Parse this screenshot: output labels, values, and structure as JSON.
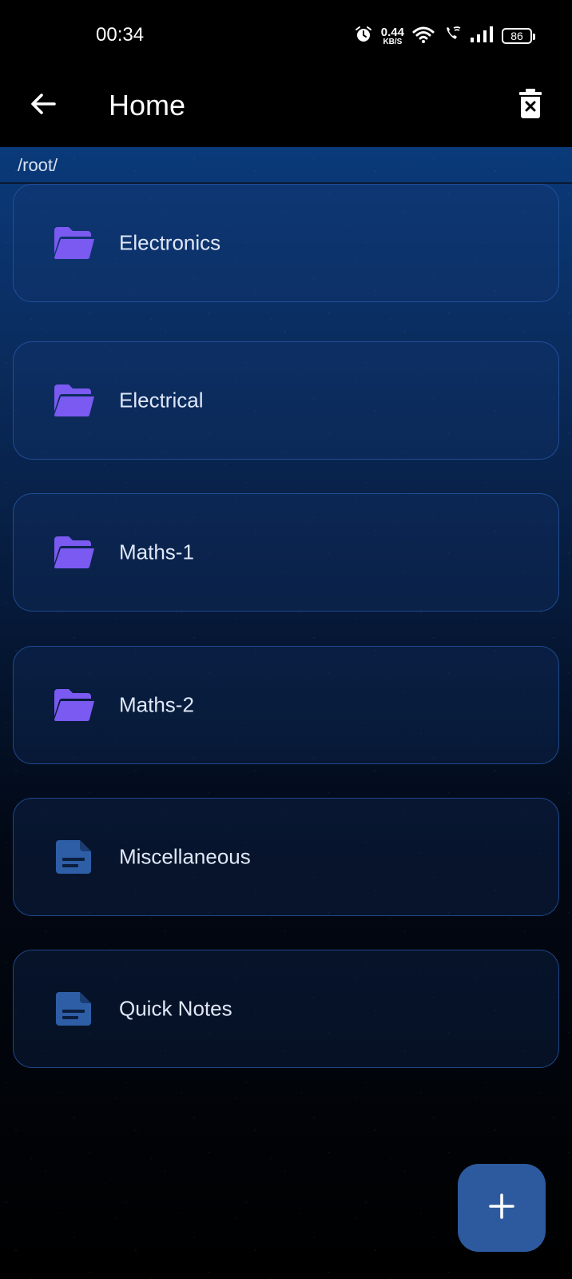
{
  "status_bar": {
    "time": "00:34",
    "net_speed_value": "0.44",
    "net_speed_unit": "KB/S",
    "battery": "86",
    "icons": [
      "alarm-icon",
      "wifi-icon",
      "wifi-calling-icon",
      "signal-icon",
      "battery-icon"
    ]
  },
  "app_bar": {
    "back_icon": "arrow-left-icon",
    "title": "Home",
    "delete_icon": "delete-bin-icon"
  },
  "path": "/root/",
  "items": [
    {
      "label": "Electronics",
      "type": "folder",
      "icon": "folder-open-icon"
    },
    {
      "label": "Electrical",
      "type": "folder",
      "icon": "folder-open-icon"
    },
    {
      "label": "Maths-1",
      "type": "folder",
      "icon": "folder-open-icon"
    },
    {
      "label": "Maths-2",
      "type": "folder",
      "icon": "folder-open-icon"
    },
    {
      "label": "Miscellaneous",
      "type": "note",
      "icon": "note-file-icon"
    },
    {
      "label": "Quick Notes",
      "type": "note",
      "icon": "note-file-icon"
    }
  ],
  "fab": {
    "icon": "plus-icon"
  },
  "colors": {
    "folder_icon": "#7a5af0",
    "note_icon": "#2e5ea6",
    "card_border": "#285aaa",
    "fab": "#2d5a9e",
    "background_top": "#0a3a7a"
  }
}
